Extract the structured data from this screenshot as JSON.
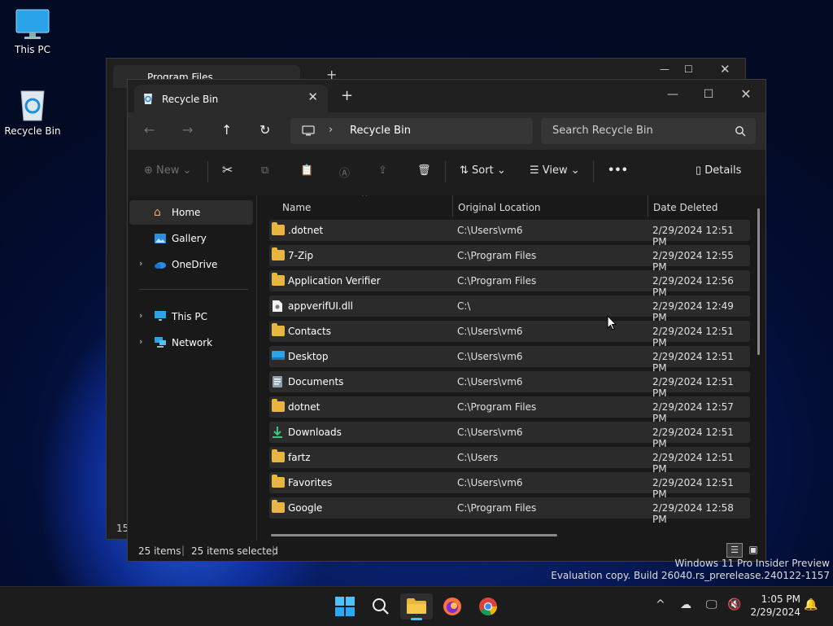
{
  "desktop": {
    "icons": [
      {
        "label": "This PC"
      },
      {
        "label": "Recycle Bin"
      }
    ]
  },
  "back_window": {
    "tab_title": "Program Files",
    "status_count": "15"
  },
  "window": {
    "tab_title": "Recycle Bin",
    "breadcrumb": "Recycle Bin",
    "search_placeholder": "Search Recycle Bin",
    "toolbar": {
      "new_label": "New",
      "sort_label": "Sort",
      "view_label": "View",
      "details_label": "Details"
    },
    "nav": [
      {
        "label": "Home"
      },
      {
        "label": "Gallery"
      },
      {
        "label": "OneDrive"
      },
      {
        "label": "This PC"
      },
      {
        "label": "Network"
      }
    ],
    "columns": {
      "name": "Name",
      "location": "Original Location",
      "date": "Date Deleted"
    },
    "rows": [
      {
        "name": ".dotnet",
        "location": "C:\\Users\\vm6",
        "date": "2/29/2024 12:51 PM",
        "icon": "folder"
      },
      {
        "name": "7-Zip",
        "location": "C:\\Program Files",
        "date": "2/29/2024 12:55 PM",
        "icon": "folder"
      },
      {
        "name": "Application Verifier",
        "location": "C:\\Program Files",
        "date": "2/29/2024 12:56 PM",
        "icon": "folder"
      },
      {
        "name": "appverifUI.dll",
        "location": "C:\\",
        "date": "2/29/2024 12:49 PM",
        "icon": "dll-file"
      },
      {
        "name": "Contacts",
        "location": "C:\\Users\\vm6",
        "date": "2/29/2024 12:51 PM",
        "icon": "folder"
      },
      {
        "name": "Desktop",
        "location": "C:\\Users\\vm6",
        "date": "2/29/2024 12:51 PM",
        "icon": "desktop"
      },
      {
        "name": "Documents",
        "location": "C:\\Users\\vm6",
        "date": "2/29/2024 12:51 PM",
        "icon": "documents"
      },
      {
        "name": "dotnet",
        "location": "C:\\Program Files",
        "date": "2/29/2024 12:57 PM",
        "icon": "folder"
      },
      {
        "name": "Downloads",
        "location": "C:\\Users\\vm6",
        "date": "2/29/2024 12:51 PM",
        "icon": "downloads"
      },
      {
        "name": "fartz",
        "location": "C:\\Users",
        "date": "2/29/2024 12:51 PM",
        "icon": "folder"
      },
      {
        "name": "Favorites",
        "location": "C:\\Users\\vm6",
        "date": "2/29/2024 12:51 PM",
        "icon": "folder"
      },
      {
        "name": "Google",
        "location": "C:\\Program Files",
        "date": "2/29/2024 12:58 PM",
        "icon": "folder"
      }
    ],
    "status": {
      "items": "25 items",
      "selected": "25 items selected"
    }
  },
  "watermark": {
    "line1": "Windows 11 Pro Insider Preview",
    "line2": "Evaluation copy. Build 26040.rs_prerelease.240122-1157"
  },
  "taskbar": {
    "time": "1:05 PM",
    "date": "2/29/2024"
  },
  "colors": {
    "accent": "#4cc2ff",
    "folder": "#e8b53e",
    "window_bg": "#191919"
  }
}
